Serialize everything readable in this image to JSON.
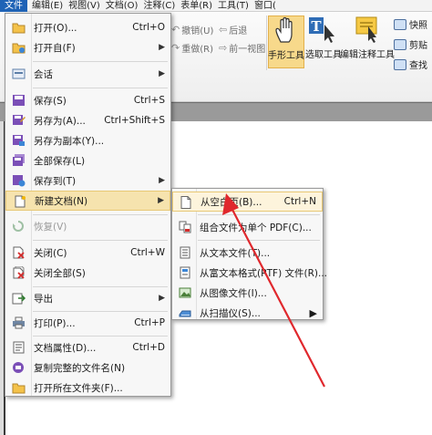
{
  "menubar": {
    "items": [
      {
        "label": "文件",
        "active": true
      },
      {
        "label": "编辑(E)"
      },
      {
        "label": "视图(V)"
      },
      {
        "label": "文档(O)"
      },
      {
        "label": "注释(C)"
      },
      {
        "label": "表单(R)"
      },
      {
        "label": "工具(T)"
      },
      {
        "label": "窗口("
      }
    ]
  },
  "ribbon": {
    "undo": "撤销(U)",
    "redo": "重做(R)",
    "back": "后退",
    "forward": "前一视图",
    "tools": [
      {
        "label": "手形工具",
        "icon": "hand-icon",
        "selected": true
      },
      {
        "label": "选取工具",
        "icon": "select-text-icon"
      },
      {
        "label": "编辑注释工具",
        "icon": "edit-annotation-icon"
      }
    ],
    "right": [
      "快照",
      "剪贴",
      "查找"
    ]
  },
  "file_menu": {
    "items": [
      {
        "label": "打开(O)...",
        "shortcut": "Ctrl+O",
        "icon": "folder-open-icon"
      },
      {
        "label": "打开自(F)",
        "submenu": true,
        "icon": "folder-from-icon"
      },
      {
        "label": "会话",
        "submenu": true,
        "icon": "session-icon"
      },
      {
        "label": "保存(S)",
        "shortcut": "Ctrl+S",
        "icon": "save-icon"
      },
      {
        "label": "另存为(A)...",
        "shortcut": "Ctrl+Shift+S",
        "icon": "save-as-icon"
      },
      {
        "label": "另存为副本(Y)...",
        "icon": "save-copy-icon"
      },
      {
        "label": "全部保存(L)",
        "icon": "save-all-icon"
      },
      {
        "label": "保存到(T)",
        "submenu": true,
        "icon": "save-to-icon"
      },
      {
        "label": "新建文档(N)",
        "submenu": true,
        "icon": "new-document-icon",
        "highlighted": true
      },
      {
        "label": "恢复(V)",
        "disabled": true,
        "icon": "revert-icon"
      },
      {
        "label": "关闭(C)",
        "shortcut": "Ctrl+W",
        "icon": "close-doc-icon"
      },
      {
        "label": "关闭全部(S)",
        "icon": "close-all-icon"
      },
      {
        "label": "导出",
        "submenu": true,
        "icon": "export-icon"
      },
      {
        "label": "打印(P)...",
        "shortcut": "Ctrl+P",
        "icon": "print-icon"
      },
      {
        "label": "文档属性(D)...",
        "shortcut": "Ctrl+D",
        "icon": "properties-icon"
      },
      {
        "label": "复制完整的文件名(N)",
        "icon": "copy-filename-icon"
      },
      {
        "label": "打开所在文件夹(F)...",
        "icon": "open-folder-icon"
      }
    ]
  },
  "new_doc_submenu": {
    "items": [
      {
        "label": "从空白页(B)...",
        "shortcut": "Ctrl+N",
        "icon": "blank-page-icon",
        "highlighted": true
      },
      {
        "label": "组合文件为单个 PDF(C)...",
        "icon": "combine-icon"
      },
      {
        "label": "从文本文件(T)...",
        "icon": "text-file-icon"
      },
      {
        "label": "从富文本格式(RTF) 文件(R)...",
        "icon": "rtf-file-icon"
      },
      {
        "label": "从图像文件(I)...",
        "icon": "image-file-icon"
      },
      {
        "label": "从扫描仪(S)...",
        "submenu": true,
        "icon": "scanner-icon"
      }
    ]
  },
  "colors": {
    "menu_active": "#1f63b6",
    "highlight": "#f6e3ae",
    "arrow": "#e0282d"
  }
}
